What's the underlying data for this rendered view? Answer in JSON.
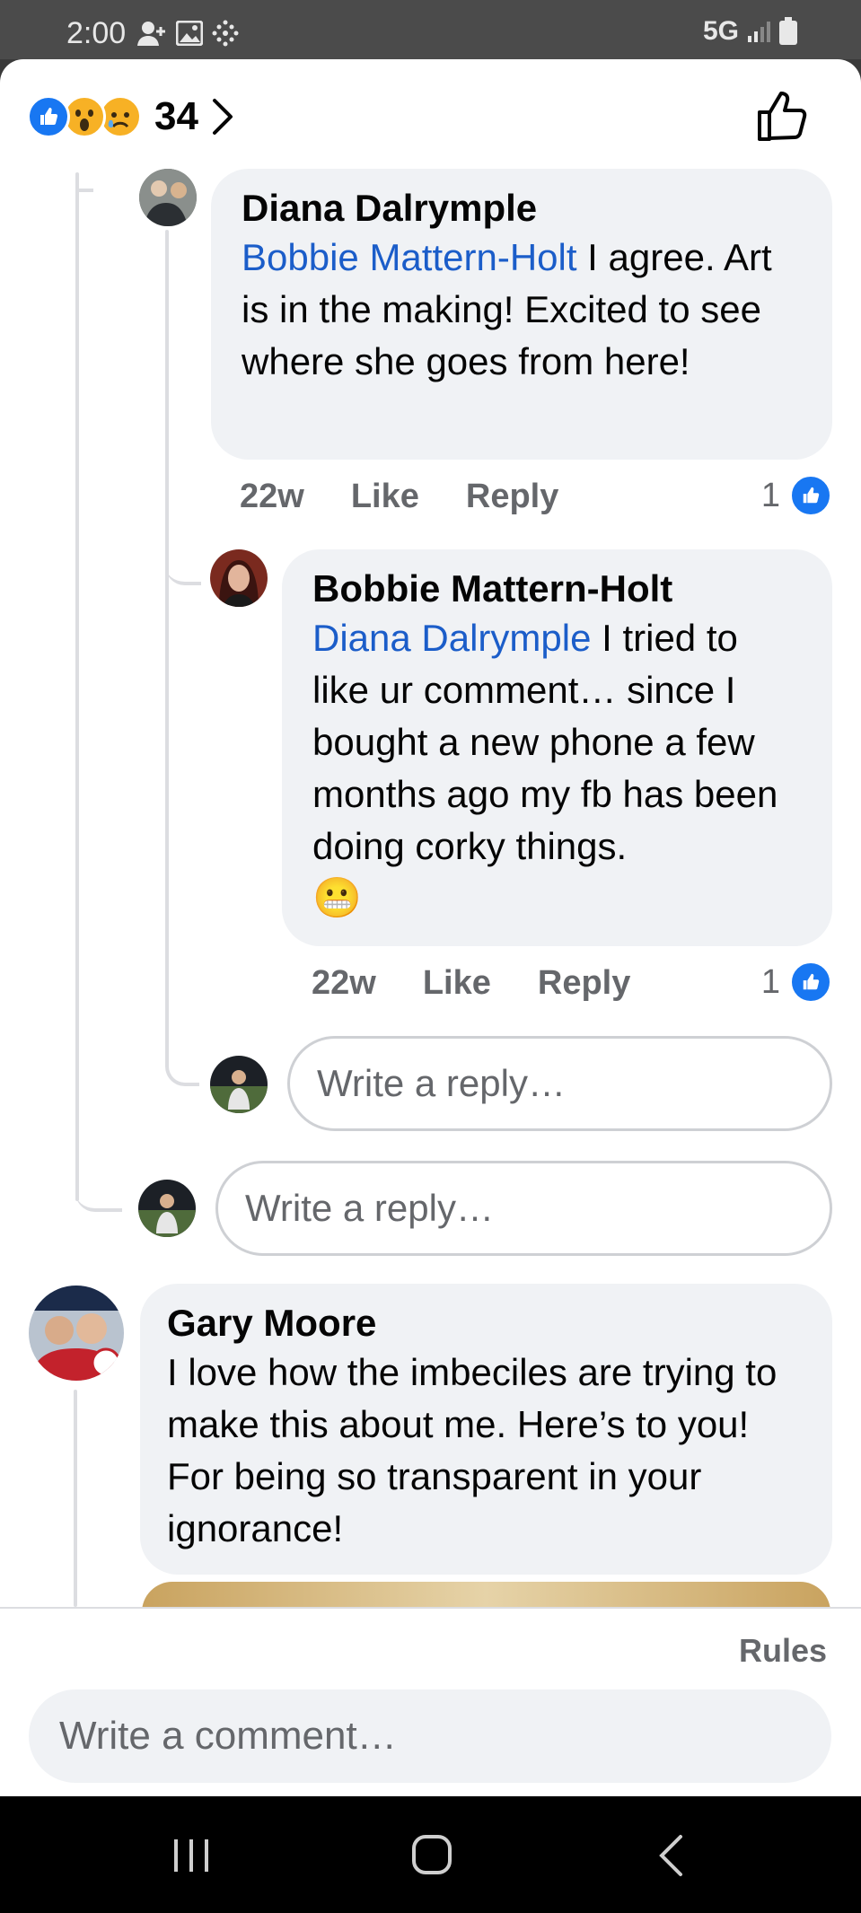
{
  "status_bar": {
    "time": "2:00",
    "network": "5G"
  },
  "header": {
    "reaction_count": "34"
  },
  "comments": [
    {
      "author": "Diana Dalrymple",
      "mention": "Bobbie Mattern-Holt",
      "text": " I agree. Art is in the making! Excited to see where she goes from here!",
      "time": "22w",
      "like_label": "Like",
      "reply_label": "Reply",
      "likes": "1"
    },
    {
      "author": "Bobbie Mattern-Holt",
      "mention": "Diana Dalrymple",
      "text": " I tried to like ur comment… since I bought a new phone a few months ago my fb has been doing corky things.",
      "emoji": "😬",
      "time": "22w",
      "like_label": "Like",
      "reply_label": "Reply",
      "likes": "1"
    },
    {
      "author": "Gary Moore",
      "text": "I love how the imbeciles are trying to make this about me. Here’s to you! For being so transparent in your ignorance!"
    }
  ],
  "reply_placeholder": "Write a reply…",
  "footer": {
    "rules_label": "Rules",
    "comment_placeholder": "Write a comment…"
  },
  "colors": {
    "accent": "#1877f2",
    "mention": "#1b5dc9",
    "bubble": "#f0f2f5"
  }
}
